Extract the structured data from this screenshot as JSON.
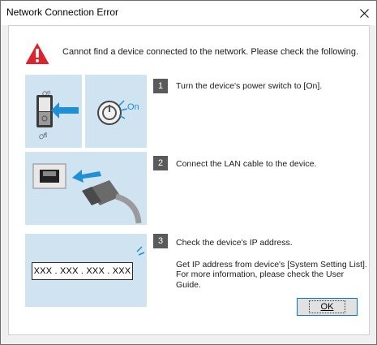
{
  "window": {
    "title": "Network Connection Error",
    "close_icon": "close-icon"
  },
  "warning": {
    "icon": "warning-icon",
    "message": "Cannot find a device connected to the network. Please check the following."
  },
  "steps": [
    {
      "number": "1",
      "text": "Turn the device's power switch to [On].",
      "illustration": {
        "switch_on_label": "On",
        "switch_off_label": "Off",
        "button_on_label": "On"
      }
    },
    {
      "number": "2",
      "text": "Connect the LAN cable to the device."
    },
    {
      "number": "3",
      "text": "Check the device's IP address.",
      "detail_line1": "Get IP address from device's [System Setting List].",
      "detail_line2": "For more information, please check the User Guide.",
      "ip_placeholder": "XXX . XXX . XXX . XXX"
    }
  ],
  "buttons": {
    "ok_label": "OK"
  },
  "colors": {
    "panel_bg": "#cfe3f1",
    "accent_blue": "#1f8fd6",
    "warning_red": "#d9262c",
    "step_badge": "#5a5a5a"
  }
}
